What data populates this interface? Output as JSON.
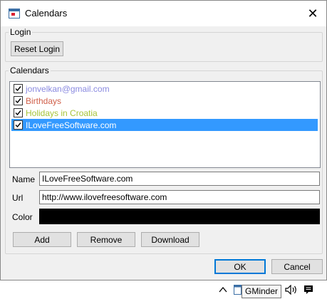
{
  "window": {
    "title": "Calendars",
    "close_glyph": "✕"
  },
  "login": {
    "group_label": "Login",
    "reset_button": "Reset Login"
  },
  "calendars": {
    "group_label": "Calendars",
    "items": [
      {
        "label": "jonvelkan@gmail.com",
        "color": "#8a8ae0",
        "checked": true,
        "selected": false
      },
      {
        "label": "Birthdays",
        "color": "#d0604a",
        "checked": true,
        "selected": false
      },
      {
        "label": "Holidays in Croatia",
        "color": "#a6c43a",
        "checked": true,
        "selected": false
      },
      {
        "label": "ILoveFreeSoftware.com",
        "color": "#ffffff",
        "checked": true,
        "selected": true
      }
    ],
    "name_label": "Name",
    "name_value": "ILoveFreeSoftware.com",
    "url_label": "Url",
    "url_value": "http://www.ilovefreesoftware.com",
    "color_label": "Color",
    "color_value": "#000000",
    "add_button": "Add",
    "remove_button": "Remove",
    "download_button": "Download"
  },
  "dialog": {
    "ok_button": "OK",
    "cancel_button": "Cancel"
  },
  "taskbar": {
    "tray_tooltip": "GMinder",
    "icons": [
      "chevron-up-icon",
      "gminder-tray-icon",
      "speaker-icon",
      "notification-icon"
    ]
  }
}
